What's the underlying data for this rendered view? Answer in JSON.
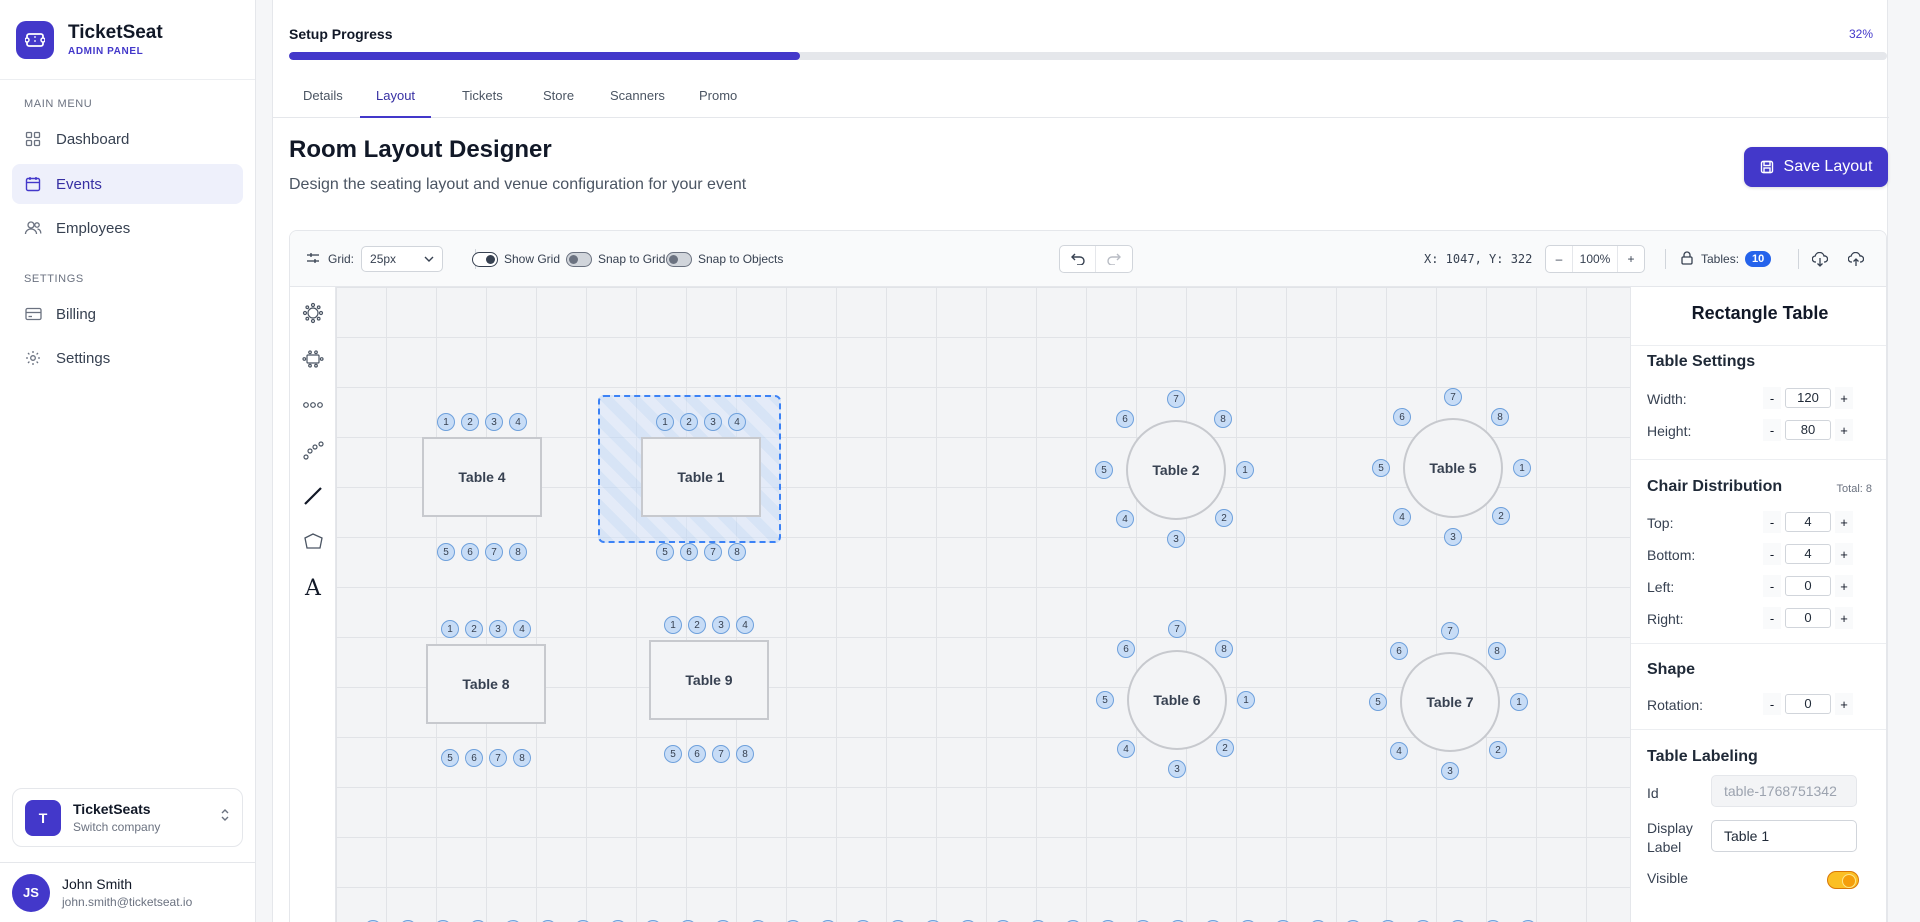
{
  "brand": {
    "name": "TicketSeat",
    "subtitle": "ADMIN PANEL"
  },
  "sidebar": {
    "main_menu_label": "MAIN MENU",
    "settings_label": "SETTINGS",
    "items": [
      {
        "label": "Dashboard",
        "icon": "grid-icon"
      },
      {
        "label": "Events",
        "icon": "calendar-icon",
        "active": true
      },
      {
        "label": "Employees",
        "icon": "users-icon"
      },
      {
        "label": "Billing",
        "icon": "credit-card-icon"
      },
      {
        "label": "Settings",
        "icon": "gear-icon"
      }
    ],
    "company": {
      "initial": "T",
      "name": "TicketSeats",
      "action": "Switch company"
    },
    "user": {
      "initials": "JS",
      "name": "John Smith",
      "email": "john.smith@ticketseat.io"
    }
  },
  "progress": {
    "label": "Setup Progress",
    "percent_text": "32%",
    "value": 0.32
  },
  "tabs": [
    "Details",
    "Layout",
    "Tickets",
    "Store",
    "Scanners",
    "Promo"
  ],
  "page": {
    "title": "Room Layout Designer",
    "subtitle": "Design the seating layout and venue configuration for your event",
    "save_label": "Save Layout"
  },
  "toolbar": {
    "grid_label": "Grid:",
    "grid_value": "25px",
    "show_grid": "Show Grid",
    "snap_grid": "Snap to Grid",
    "snap_objects": "Snap to Objects",
    "coords": "X: 1047, Y: 322",
    "zoom": "100%",
    "tables_label": "Tables:",
    "tables_count": "10"
  },
  "tables": {
    "t4": "Table 4",
    "t1": "Table 1",
    "t8": "Table 8",
    "t9": "Table 9",
    "t2": "Table 2",
    "t5": "Table 5",
    "t6": "Table 6",
    "t7": "Table 7"
  },
  "props": {
    "title": "Rectangle Table",
    "table_settings": "Table Settings",
    "width_label": "Width:",
    "width": "120",
    "height_label": "Height:",
    "height": "80",
    "chair_distribution": "Chair Distribution",
    "total": "Total: 8",
    "top_label": "Top:",
    "top": "4",
    "bottom_label": "Bottom:",
    "bottom": "4",
    "left_label": "Left:",
    "left": "0",
    "right_label": "Right:",
    "right": "0",
    "shape": "Shape",
    "rotation_label": "Rotation:",
    "rotation": "0",
    "table_labeling": "Table Labeling",
    "id_label": "Id",
    "id_value": "table-1768751342",
    "display_label_1": "Display",
    "display_label_2": "Label",
    "display_value": "Table 1",
    "visible_label": "Visible"
  },
  "colors": {
    "accent": "#4338ca",
    "chair": "#c7dcf6",
    "selection": "#3b82f6",
    "toggle_on": "#fbbf24"
  }
}
